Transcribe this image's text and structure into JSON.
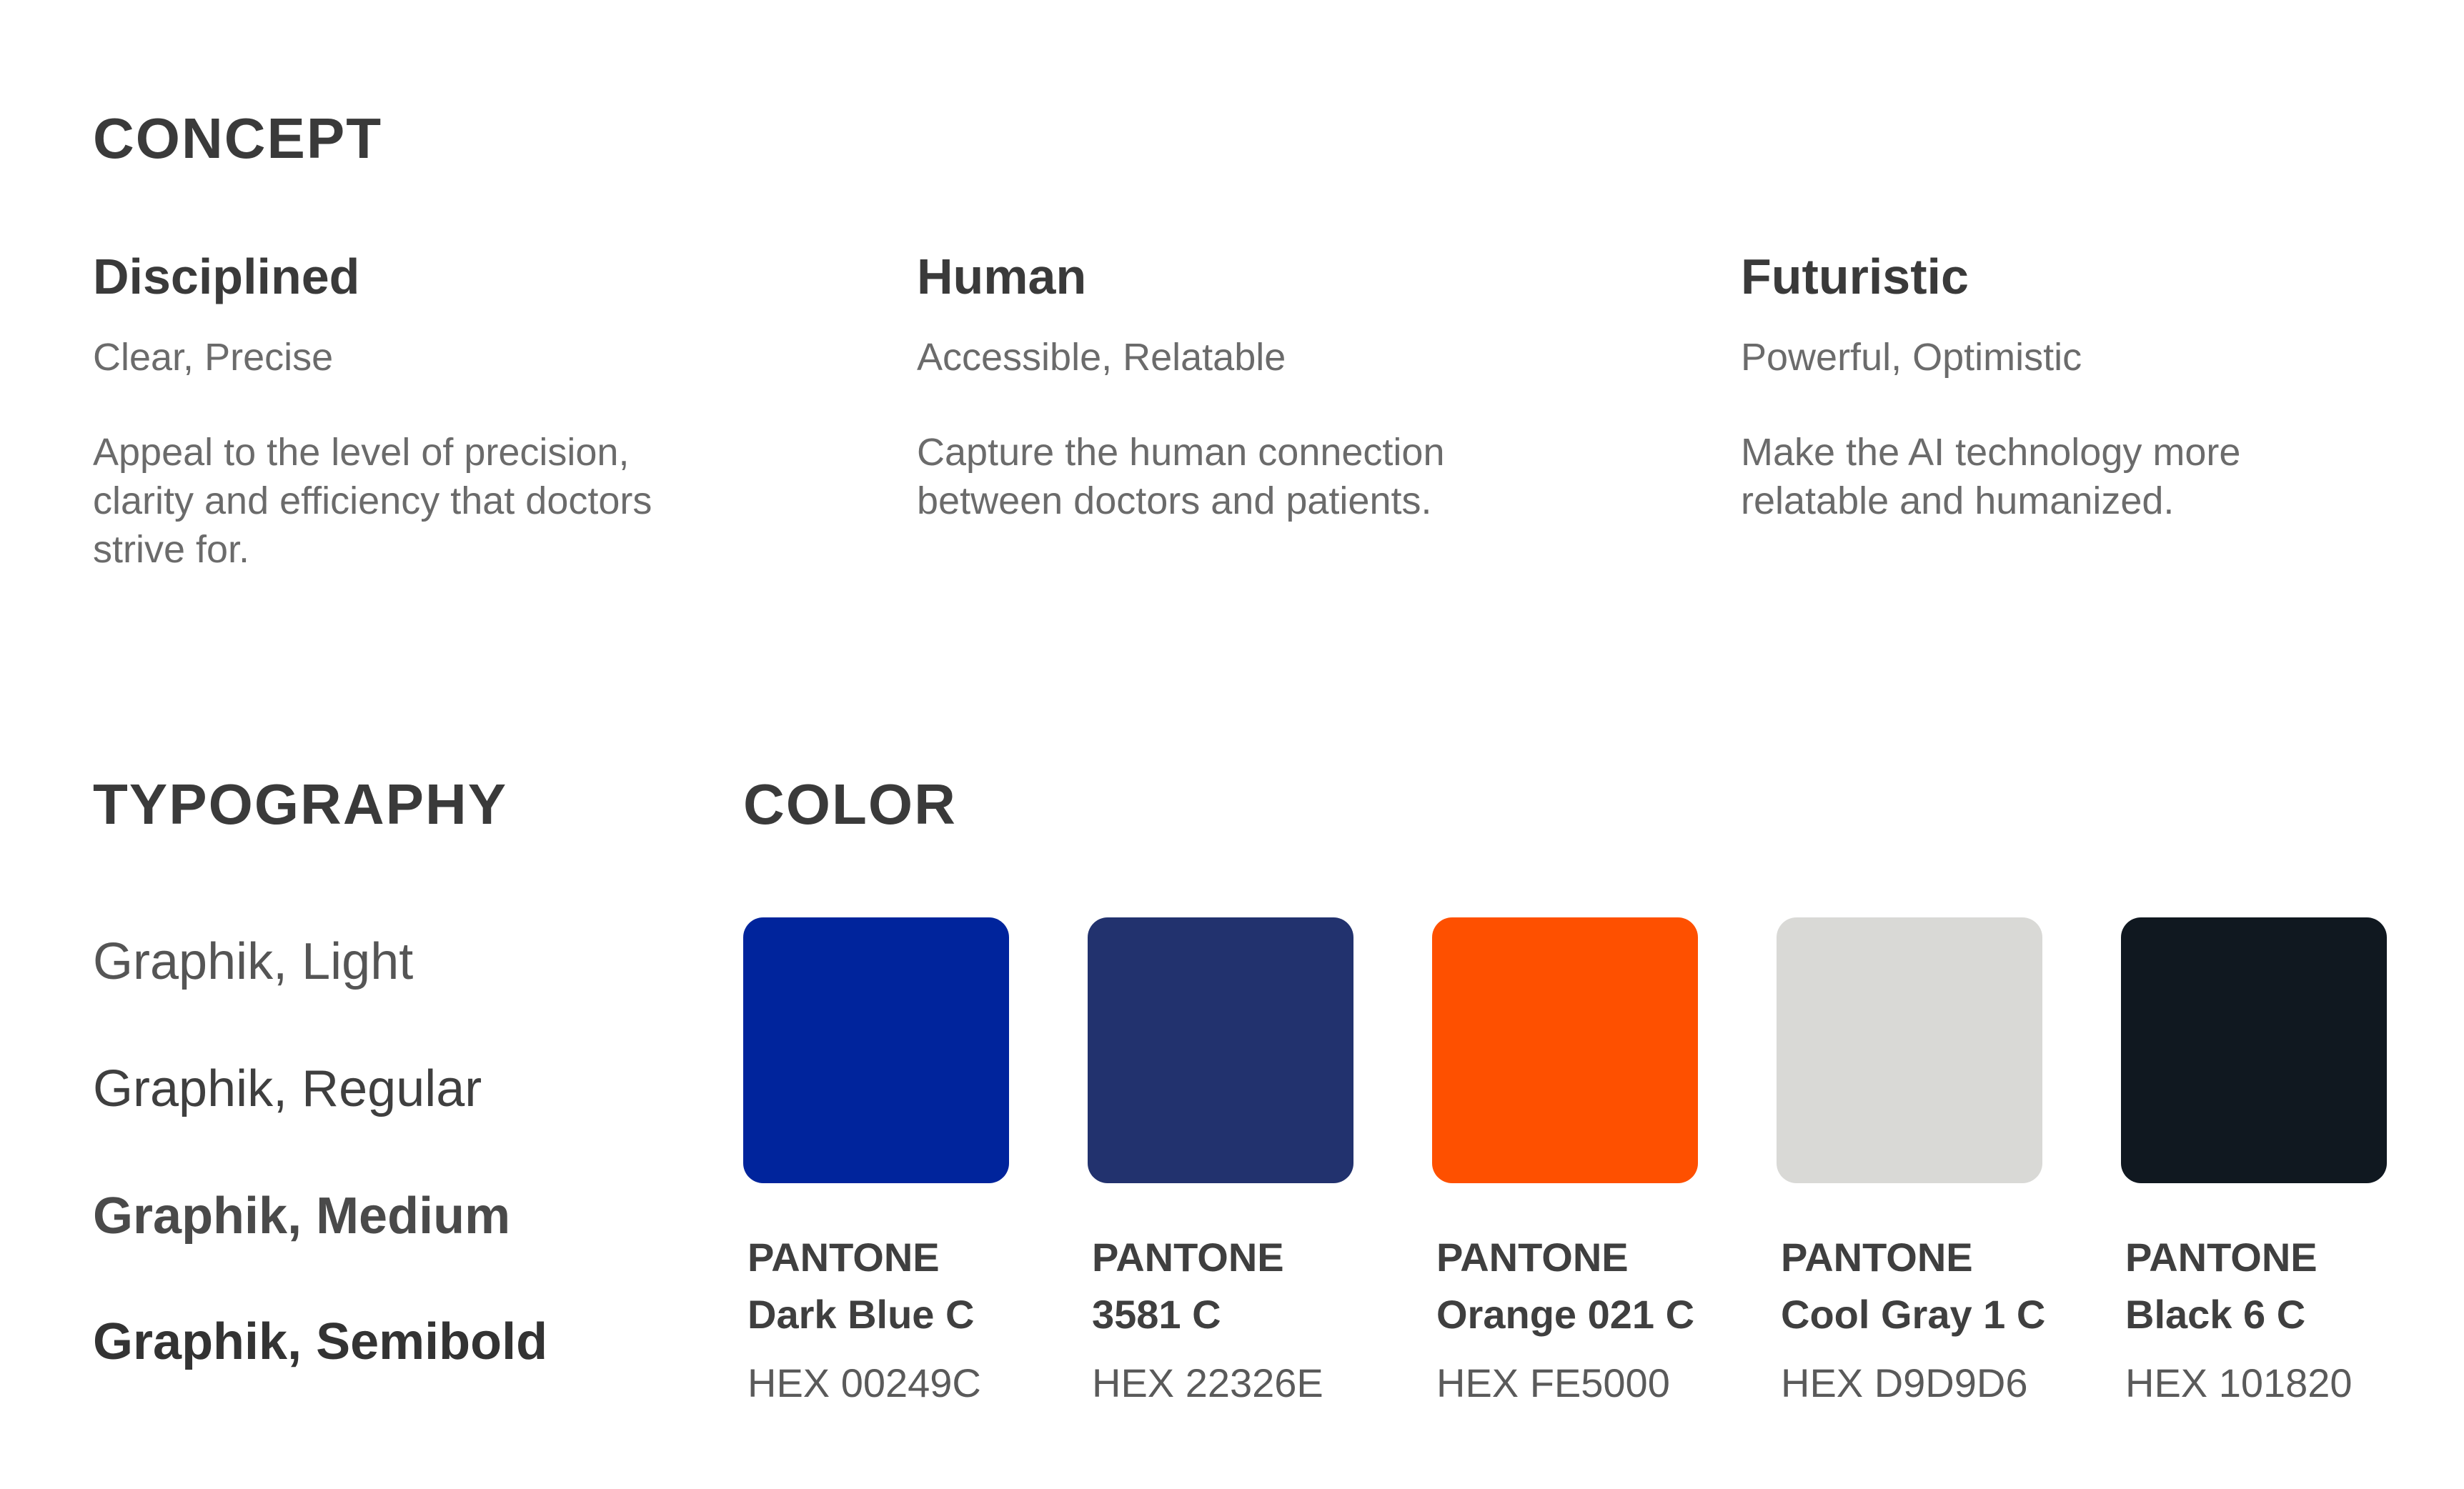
{
  "concept": {
    "title": "CONCEPT",
    "columns": [
      {
        "heading": "Disciplined",
        "subheading": "Clear, Precise",
        "description": "Appeal to the level of precision, clarity and efficiency that doctors strive for."
      },
      {
        "heading": "Human",
        "subheading": "Accessible, Relatable",
        "description": "Capture the human connection between doctors and patients."
      },
      {
        "heading": "Futuristic",
        "subheading": "Powerful, Optimistic",
        "description": "Make the AI technology more relatable and humanized."
      }
    ]
  },
  "typography": {
    "title": "TYPOGRAPHY",
    "samples": [
      "Graphik, Light",
      "Graphik, Regular",
      "Graphik, Medium",
      "Graphik, Semibold"
    ]
  },
  "color": {
    "title": "COLOR",
    "swatches": [
      {
        "line1": "PANTONE",
        "line2": "Dark Blue C",
        "hex_label": "HEX 00249C",
        "color": "#00249C"
      },
      {
        "line1": "PANTONE",
        "line2": "3581 C",
        "hex_label": "HEX 22326E",
        "color": "#22326E"
      },
      {
        "line1": "PANTONE",
        "line2": "Orange 021 C",
        "hex_label": "HEX FE5000",
        "color": "#FE5000"
      },
      {
        "line1": "PANTONE",
        "line2": "Cool Gray 1 C",
        "hex_label": "HEX D9D9D6",
        "color": "#D9D9D6"
      },
      {
        "line1": "PANTONE",
        "line2": "Black 6 C",
        "hex_label": "HEX 101820",
        "color": "#101820"
      }
    ]
  }
}
